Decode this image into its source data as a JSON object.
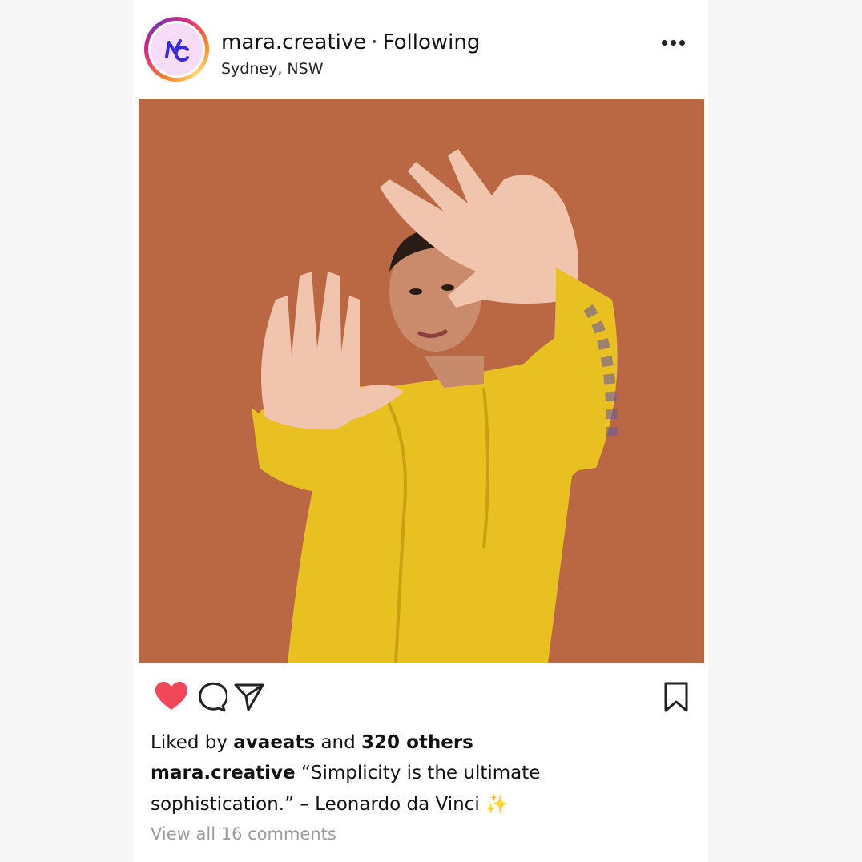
{
  "post": {
    "username": "mara.creative",
    "separator": "·",
    "follow_status": "Following",
    "location": "Sydney, NSW",
    "avatar_monogram": "MC",
    "more_icon": "more-horizontal-icon"
  },
  "photo": {
    "background_color": "#b96843",
    "dress_color": "#e8c022"
  },
  "actions": {
    "like_icon": "heart-icon",
    "comment_icon": "comment-icon",
    "share_icon": "send-icon",
    "save_icon": "bookmark-icon",
    "like_color": "#f0475b"
  },
  "likes": {
    "prefix": "Liked by",
    "user": "avaeats",
    "conjunction": "and",
    "others": "320 others"
  },
  "caption": {
    "username": "mara.creative",
    "text": "“Simplicity is the ultimate sophistication.” – Leonardo da Vinci",
    "emoji": "✨"
  },
  "comments": {
    "view_all": "View all 16 comments"
  }
}
